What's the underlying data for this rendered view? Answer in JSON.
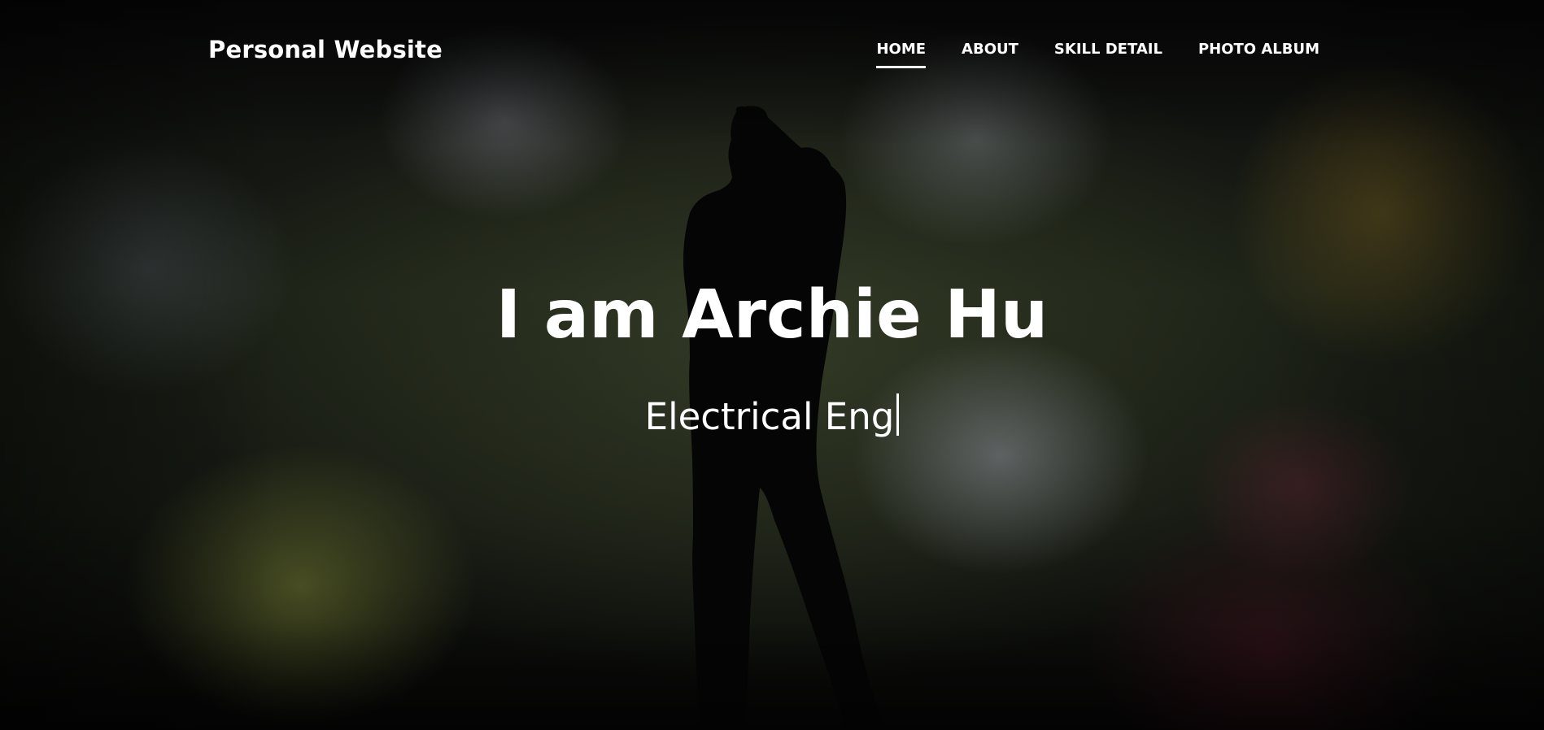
{
  "navbar": {
    "brand": "Personal Website",
    "items": [
      {
        "label": "HOME",
        "active": true
      },
      {
        "label": "ABOUT",
        "active": false
      },
      {
        "label": "SKILL DETAIL",
        "active": false
      },
      {
        "label": "PHOTO ALBUM",
        "active": false
      }
    ]
  },
  "hero": {
    "title": "I am Archie Hu",
    "typed_text": "Electrical Eng"
  },
  "colors": {
    "text": "#ffffff",
    "background": "#000000"
  }
}
